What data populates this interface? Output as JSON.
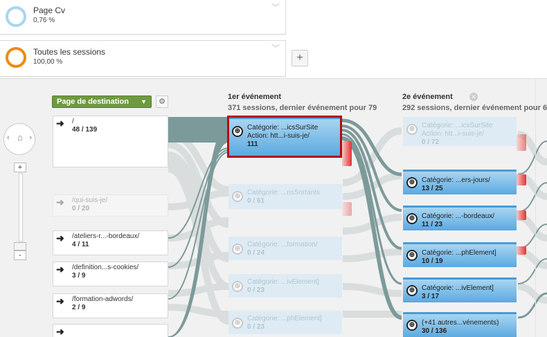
{
  "segments": [
    {
      "name": "Page Cv",
      "pct": "0,76 %",
      "ring_color": "#a9d6ef"
    },
    {
      "name": "Toutes les sessions",
      "pct": "100,00 %",
      "ring_color": "#ef8a16"
    }
  ],
  "add_segment_label": "+",
  "controls": {
    "destination_button": "Page de destination",
    "gear_icon": "gear-icon",
    "zoom_plus": "+",
    "zoom_minus": "-"
  },
  "columns": [
    {
      "title": "1er événement",
      "subtitle": "371 sessions, dernier événement pour 79"
    },
    {
      "title": "2e événement",
      "subtitle": "292 sessions, dernier événement pour 6"
    }
  ],
  "pages": [
    {
      "path": "/",
      "count": "48 / 139"
    },
    {
      "path": "/qui-suis-je/",
      "count": "0 / 20"
    },
    {
      "path": "/ateliers-r...-bordeaux/",
      "count": "4 / 11"
    },
    {
      "path": "/definition...s-cookies/",
      "count": "3 / 9"
    },
    {
      "path": "/formation-adwords/",
      "count": "2 / 9"
    }
  ],
  "events1": [
    {
      "l1": "Catégorie: ...icsSurSite",
      "l2": "Action: htt...i-suis-je/",
      "l3": "111"
    },
    {
      "l1": "Catégorie: ...nsSortants",
      "l2": "",
      "l3": "0 / 61"
    },
    {
      "l1": "Catégorie: ...formation/",
      "l2": "",
      "l3": "0 / 24"
    },
    {
      "l1": "Catégorie: ...ivElement]",
      "l2": "",
      "l3": "0 / 23"
    },
    {
      "l1": "Catégorie: ...phElement]",
      "l2": "",
      "l3": "0 / 23"
    }
  ],
  "events2": [
    {
      "l1": "Catégorie: ...icsSurSite",
      "l2": "Action: htt...i-suis-je/",
      "l3": "0 / 72"
    },
    {
      "l1": "Catégorie: ...ers-jours/",
      "l2": "",
      "l3": "13 / 25"
    },
    {
      "l1": "Catégorie: ...-bordeaux/",
      "l2": "",
      "l3": "11 / 23"
    },
    {
      "l1": "Catégorie: ...phElement]",
      "l2": "",
      "l3": "10 / 19"
    },
    {
      "l1": "Catégorie: ...ivElement]",
      "l2": "",
      "l3": "3 / 17"
    },
    {
      "l1": "(+41 autres...vénements)",
      "l2": "",
      "l3": "30 / 136"
    }
  ],
  "colors": {
    "flow": "#7d9a9a",
    "accent_green": "#6e9a3f",
    "highlight_red": "#b10d14",
    "event_blue": "#5aa9e0"
  }
}
